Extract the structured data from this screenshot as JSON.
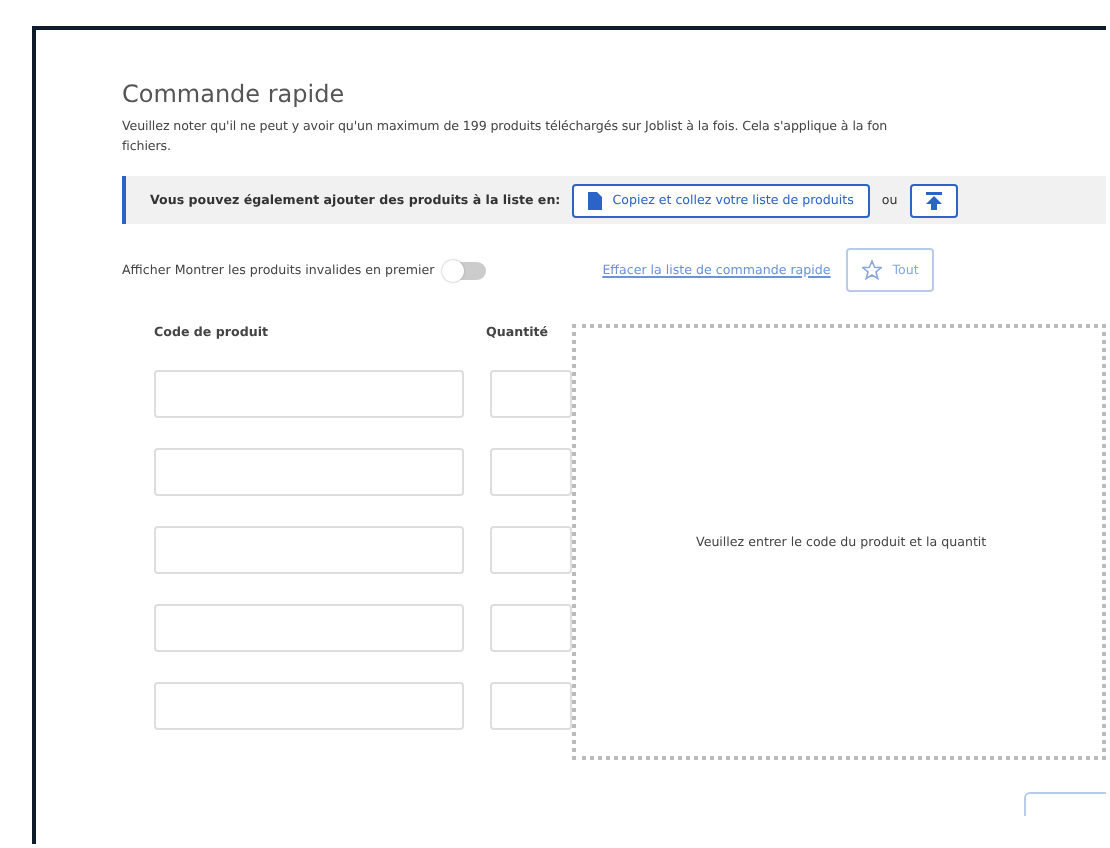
{
  "title": "Commande rapide",
  "note_lines": [
    "Veuillez noter qu'il ne peut y avoir qu'un maximum de 199 produits téléchargés sur Joblist à la fois. Cela s'applique à la fon",
    "fichiers."
  ],
  "info_bar": {
    "text": "Vous pouvez également ajouter des produits à la liste en:",
    "paste_button": "Copiez et collez votre liste de produits",
    "separator": "ou"
  },
  "toggle": {
    "label": "Afficher Montrer les produits invalides en premier",
    "on": false
  },
  "clear_link": "Effacer la liste de commande rapide",
  "favorites_button": "Tout",
  "columns": [
    "Code de produit",
    "Quantité"
  ],
  "rows": [
    {},
    {},
    {},
    {},
    {}
  ],
  "empty_message": "Veuillez entrer le code du produit et la quantit"
}
